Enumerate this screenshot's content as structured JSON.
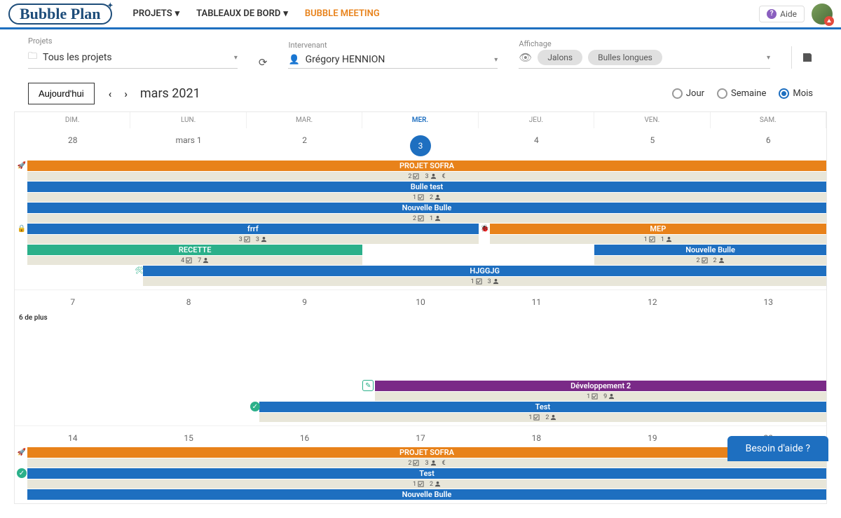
{
  "header": {
    "logo": "Bubble Plan",
    "nav": {
      "projets": "PROJETS",
      "tableaux": "TABLEAUX DE BORD",
      "meeting": "BUBBLE MEETING"
    },
    "help": "Aide"
  },
  "filters": {
    "projets": {
      "label": "Projets",
      "value": "Tous les projets"
    },
    "intervenant": {
      "label": "Intervenant",
      "value": "Grégory HENNION"
    },
    "affichage": {
      "label": "Affichage",
      "jalons": "Jalons",
      "bulles": "Bulles longues"
    }
  },
  "toolbar": {
    "today": "Aujourd'hui",
    "period": "mars 2021",
    "views": {
      "jour": "Jour",
      "semaine": "Semaine",
      "mois": "Mois"
    }
  },
  "days": [
    "DIM.",
    "LUN.",
    "MAR.",
    "MER.",
    "JEU.",
    "VEN.",
    "SAM."
  ],
  "week1_dates": [
    "28",
    "mars 1",
    "2",
    "3",
    "4",
    "5",
    "6"
  ],
  "week2_dates": [
    "7",
    "8",
    "9",
    "10",
    "11",
    "12",
    "13"
  ],
  "week3_dates": [
    "14",
    "15",
    "16",
    "17",
    "18",
    "19",
    "20"
  ],
  "more_text": "6 de plus",
  "events": {
    "sofra": "PROJET SOFRA",
    "bulle_test": "Bulle test",
    "nouvelle_bulle": "Nouvelle Bulle",
    "frrf": "frrf",
    "mep": "MEP",
    "recette": "RECETTE",
    "hjggjg": "HJGGJG",
    "dev2": "Développement 2",
    "test": "Test"
  },
  "meta": {
    "sofra": {
      "a": "2",
      "b": "3",
      "euro": "€"
    },
    "bulle_test": {
      "a": "1",
      "b": "2"
    },
    "nouvelle_bulle": {
      "a": "2",
      "b": "1"
    },
    "frrf": {
      "a": "3",
      "b": "3"
    },
    "mep": {
      "a": "1",
      "b": "1"
    },
    "recette": {
      "a": "4",
      "b": "7"
    },
    "nouvelle_bulle2": {
      "a": "2",
      "b": "2"
    },
    "hjggjg": {
      "a": "1",
      "b": "3"
    },
    "dev2": {
      "a": "1",
      "b": "9"
    },
    "test": {
      "a": "1",
      "b": "2"
    },
    "sofra2": {
      "a": "2",
      "b": "3",
      "euro": "€"
    },
    "test2": {
      "a": "1",
      "b": "2"
    }
  },
  "help_widget": "Besoin d'aide ?"
}
